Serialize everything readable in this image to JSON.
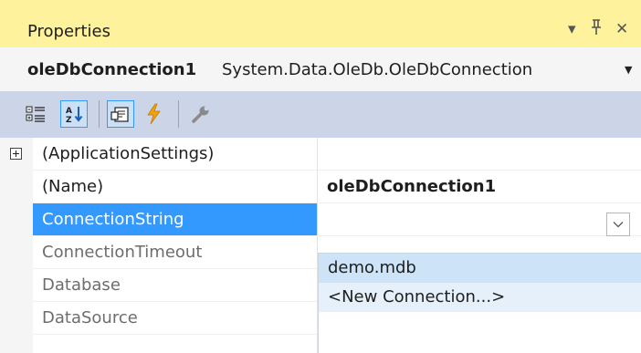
{
  "window": {
    "title": "Properties",
    "controls": {
      "dropdown": "▾",
      "pin": "📌",
      "close": "✕"
    }
  },
  "object_selector": {
    "name": "oleDbConnection1",
    "type": "System.Data.OleDb.OleDbConnection"
  },
  "toolbar": {
    "buttons": [
      {
        "icon": "categorized-icon",
        "active": false
      },
      {
        "icon": "alphabetical-sort-icon",
        "active": true
      },
      {
        "icon": "properties-icon",
        "active": true
      },
      {
        "icon": "events-lightning-icon",
        "active": false
      },
      {
        "icon": "property-pages-wrench-icon",
        "active": false
      }
    ]
  },
  "properties": [
    {
      "name": "(ApplicationSettings)",
      "value": "",
      "expandable": true,
      "state": "normal"
    },
    {
      "name": "(Name)",
      "value": "oleDbConnection1",
      "value_bold": true,
      "state": "normal"
    },
    {
      "name": "ConnectionString",
      "value": "",
      "state": "selected"
    },
    {
      "name": "ConnectionTimeout",
      "value": "",
      "state": "disabled"
    },
    {
      "name": "Database",
      "value": "",
      "state": "disabled"
    },
    {
      "name": "DataSource",
      "value": "",
      "state": "disabled"
    }
  ],
  "dropdown_options": [
    {
      "label": "demo.mdb",
      "highlighted": true
    },
    {
      "label": "<New Connection...>",
      "highlighted": false
    }
  ],
  "colors": {
    "title_bar": "#fff29d",
    "toolbar": "#ccd5e7",
    "selection": "#3399ff",
    "hover": "#cde3f7"
  }
}
